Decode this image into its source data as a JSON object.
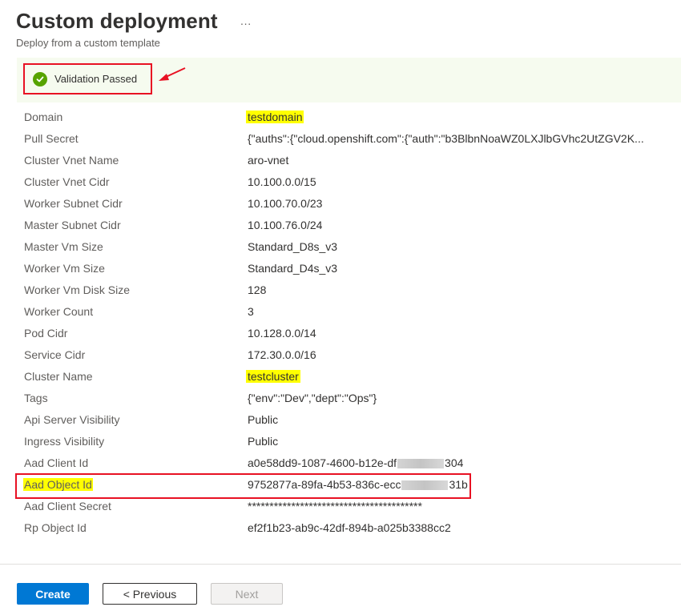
{
  "header": {
    "title": "Custom deployment",
    "more_label": "···",
    "subtitle": "Deploy from a custom template"
  },
  "validation": {
    "status_text": "Validation Passed",
    "icon": "check-circle-icon",
    "status_color": "#57a300"
  },
  "fields": [
    {
      "label": "Domain",
      "value": "testdomain"
    },
    {
      "label": "Pull Secret",
      "value": "{\"auths\":{\"cloud.openshift.com\":{\"auth\":\"b3BlbnNoaWZ0LXJlbGVhc2UtZGV2K..."
    },
    {
      "label": "Cluster Vnet Name",
      "value": "aro-vnet"
    },
    {
      "label": "Cluster Vnet Cidr",
      "value": "10.100.0.0/15"
    },
    {
      "label": "Worker Subnet Cidr",
      "value": "10.100.70.0/23"
    },
    {
      "label": "Master Subnet Cidr",
      "value": "10.100.76.0/24"
    },
    {
      "label": "Master Vm Size",
      "value": "Standard_D8s_v3"
    },
    {
      "label": "Worker Vm Size",
      "value": "Standard_D4s_v3"
    },
    {
      "label": "Worker Vm Disk Size",
      "value": "128"
    },
    {
      "label": "Worker Count",
      "value": "3"
    },
    {
      "label": "Pod Cidr",
      "value": "10.128.0.0/14"
    },
    {
      "label": "Service Cidr",
      "value": "172.30.0.0/16"
    },
    {
      "label": "Cluster Name",
      "value": "testcluster"
    },
    {
      "label": "Tags",
      "value": "{\"env\":\"Dev\",\"dept\":\"Ops\"}"
    },
    {
      "label": "Api Server Visibility",
      "value": "Public"
    },
    {
      "label": "Ingress Visibility",
      "value": "Public"
    },
    {
      "label": "Aad Client Id",
      "value_prefix": "a0e58dd9-1087-4600-b12e-df",
      "value_suffix": "304"
    },
    {
      "label": "Aad Object Id",
      "value_prefix": "9752877a-89fa-4b53-836c-ecc",
      "value_suffix": "31b"
    },
    {
      "label": "Aad Client Secret",
      "value": "****************************************"
    },
    {
      "label": "Rp Object Id",
      "value": "ef2f1b23-ab9c-42df-894b-a025b3388cc2"
    }
  ],
  "footer": {
    "create_label": "Create",
    "previous_label": "< Previous",
    "next_label": "Next"
  },
  "colors": {
    "primary": "#0078d4",
    "annotation_red": "#e81123",
    "highlight": "#ffff00",
    "banner_bg": "#f6fbef"
  }
}
